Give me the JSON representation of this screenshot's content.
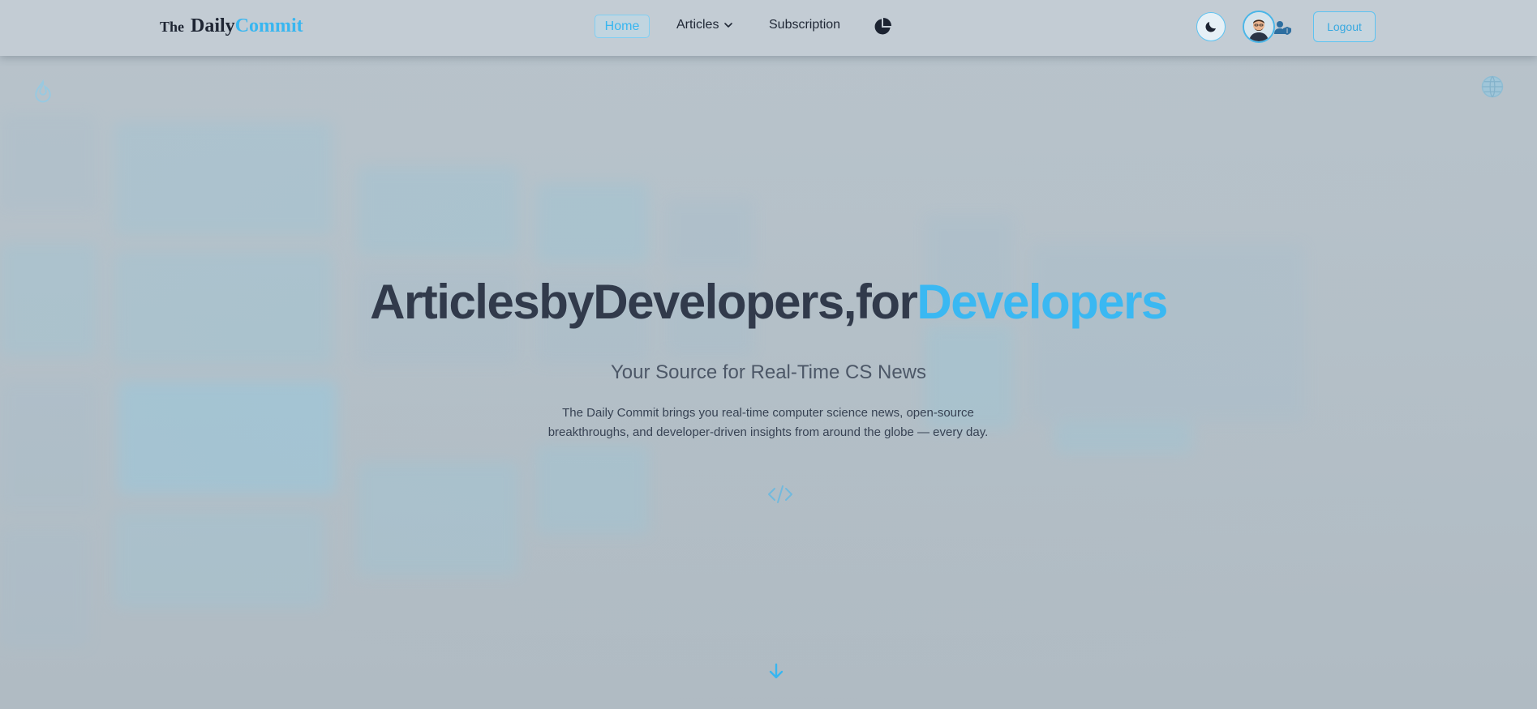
{
  "colors": {
    "accent": "#38b6f0",
    "text_dark": "#313a4b",
    "navbar_bg": "#c3ccd4",
    "page_bg": "#b6c1c9"
  },
  "navbar": {
    "logo": {
      "the": "The",
      "daily": "Daily",
      "commit": "Commit"
    },
    "home_label": "Home",
    "articles_label": "Articles",
    "subscription_label": "Subscription",
    "stats_icon": "pie-chart-icon",
    "theme_icon": "moon-icon",
    "user_icon": "user-shield-icon",
    "logout_label": "Logout"
  },
  "hero": {
    "title_part1": "ArticlesbyDevelopers,for",
    "title_accent": "Developers",
    "subtitle": "Your Source for Real-Time CS News",
    "description": "The Daily Commit brings you real-time computer science news, open-source breakthroughs, and developer-driven insights from around the globe — every day.",
    "code_icon": "code-icon",
    "scroll_icon": "arrow-down-icon"
  },
  "background": {
    "top_left_icon": "fire-icon",
    "top_right_icon": "globe-icon"
  }
}
